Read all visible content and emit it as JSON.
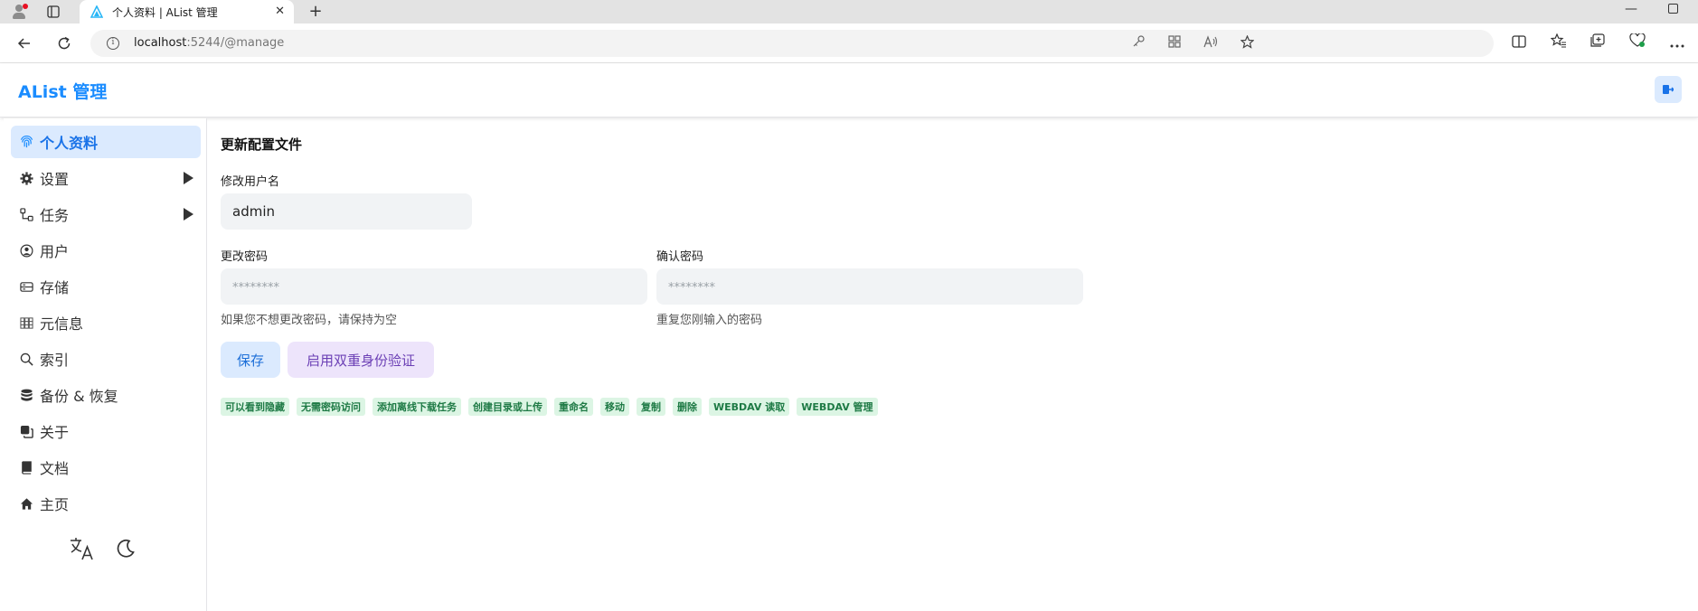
{
  "browser": {
    "tab_title": "个人资料 | AList 管理",
    "tab_close": "✕",
    "new_tab": "+",
    "url_host": "localhost",
    "url_path": ":5244/@manage",
    "window_minimize": "—"
  },
  "header": {
    "brand": "AList 管理",
    "accent_color": "#1a8cff"
  },
  "sidebar": {
    "items": [
      {
        "label": "个人资料",
        "icon": "fingerprint-icon",
        "active": true
      },
      {
        "label": "设置",
        "icon": "gear-icon",
        "expandable": true
      },
      {
        "label": "任务",
        "icon": "tasks-icon",
        "expandable": true
      },
      {
        "label": "用户",
        "icon": "user-circle-icon"
      },
      {
        "label": "存储",
        "icon": "storage-icon"
      },
      {
        "label": "元信息",
        "icon": "metadata-icon"
      },
      {
        "label": "索引",
        "icon": "search-icon"
      },
      {
        "label": "备份 & 恢复",
        "icon": "database-icon"
      },
      {
        "label": "关于",
        "icon": "copy-icon"
      },
      {
        "label": "文档",
        "icon": "book-icon"
      },
      {
        "label": "主页",
        "icon": "home-icon"
      }
    ],
    "footer": {
      "language_icon": "translate-icon",
      "theme_icon": "moon-icon"
    }
  },
  "main": {
    "section_title": "更新配置文件",
    "username": {
      "label": "修改用户名",
      "value": "admin"
    },
    "password": {
      "label": "更改密码",
      "placeholder": "********",
      "hint": "如果您不想更改密码，请保持为空"
    },
    "confirm_password": {
      "label": "确认密码",
      "placeholder": "********",
      "hint": "重复您刚输入的密码"
    },
    "buttons": {
      "save": "保存",
      "enable_2fa": "启用双重身份验证"
    },
    "permissions": [
      "可以看到隐藏",
      "无需密码访问",
      "添加离线下载任务",
      "创建目录或上传",
      "重命名",
      "移动",
      "复制",
      "删除",
      "WEBDAV 读取",
      "WEBDAV 管理"
    ]
  }
}
